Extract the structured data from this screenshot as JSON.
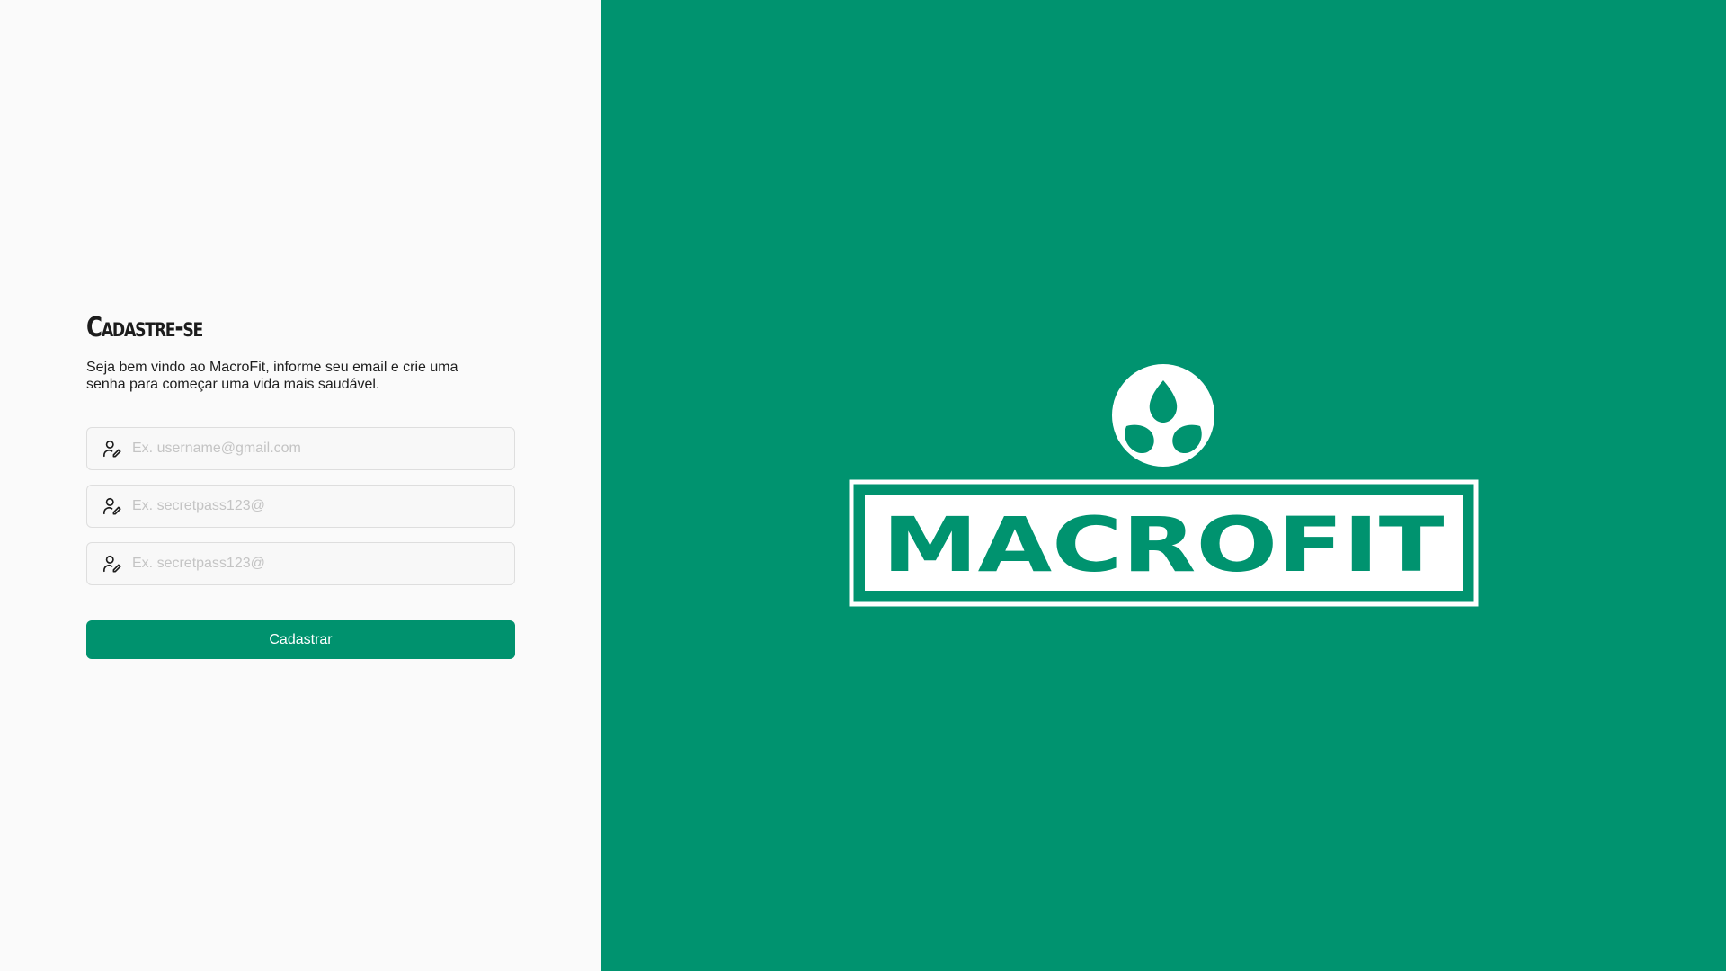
{
  "signup": {
    "title": "Cadastre-se",
    "description": "Seja bem vindo ao MacroFit, informe seu email e crie uma senha para começar uma vida mais saudável.",
    "fields": [
      {
        "icon": "user-edit-icon",
        "placeholder": "Ex. username@gmail.com",
        "value": ""
      },
      {
        "icon": "user-edit-icon",
        "placeholder": "Ex. secretpass123@",
        "value": ""
      },
      {
        "icon": "user-edit-icon",
        "placeholder": "Ex. secretpass123@",
        "value": ""
      }
    ],
    "submit_label": "Cadastrar"
  },
  "brand": {
    "logo_text": "MACROFIT",
    "logo_icon": "leaf-sprout-icon"
  },
  "colors": {
    "brand_green": "#00936f",
    "button_green": "#00926e",
    "left_background": "#fafafa",
    "logo_white": "#ffffff"
  }
}
